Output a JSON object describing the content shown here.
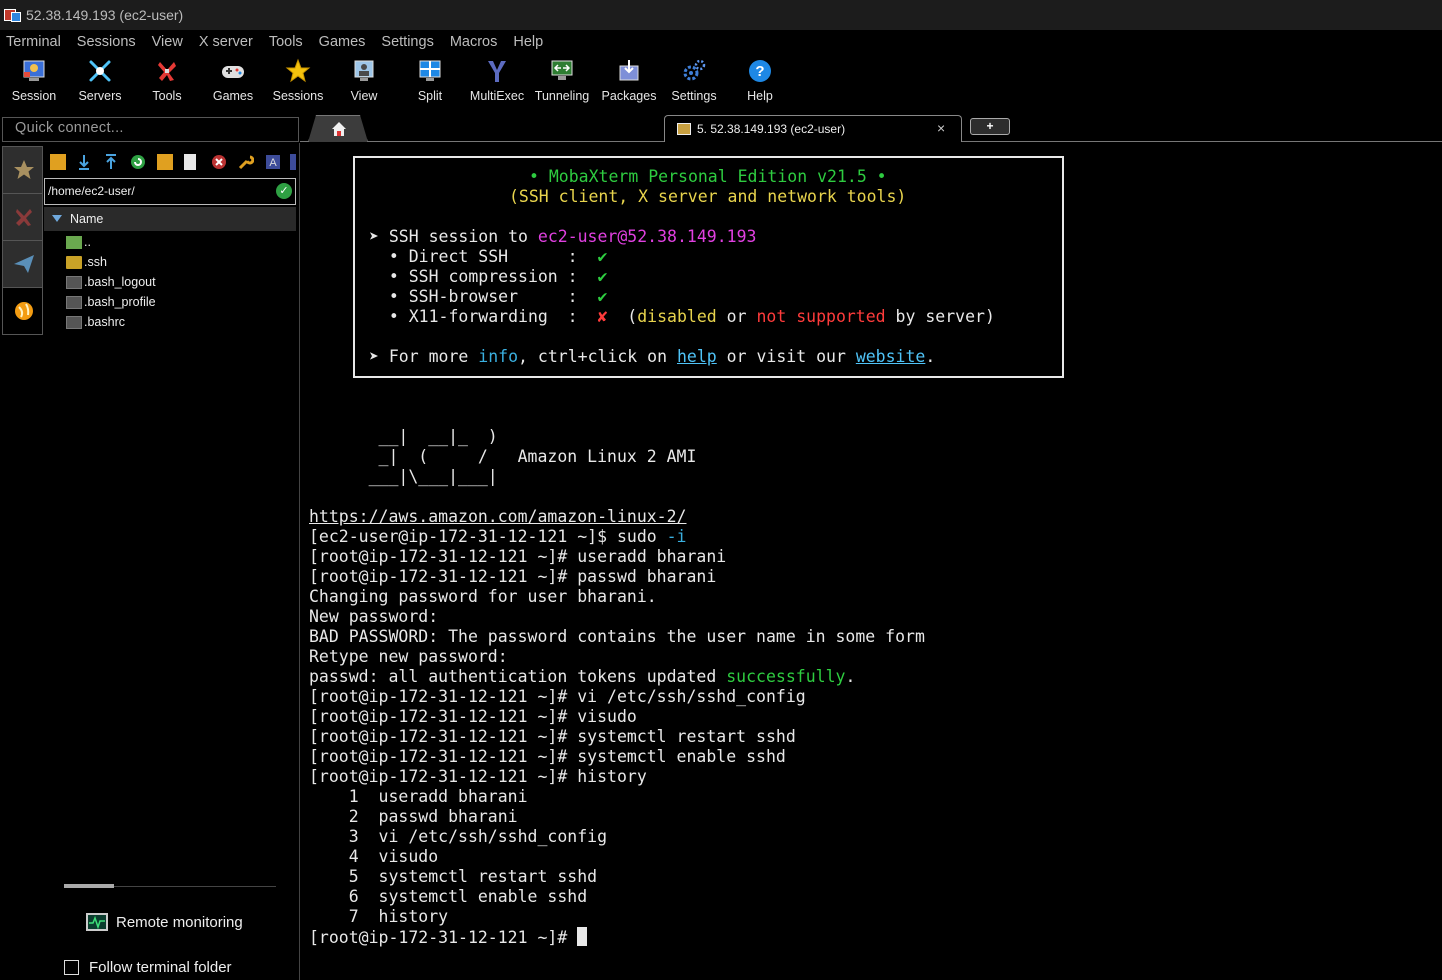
{
  "window": {
    "title": "52.38.149.193 (ec2-user)"
  },
  "menu": [
    "Terminal",
    "Sessions",
    "View",
    "X server",
    "Tools",
    "Games",
    "Settings",
    "Macros",
    "Help"
  ],
  "toolbar": [
    {
      "label": "Session",
      "icon": "session-icon"
    },
    {
      "label": "Servers",
      "icon": "servers-icon"
    },
    {
      "label": "Tools",
      "icon": "tools-icon"
    },
    {
      "label": "Games",
      "icon": "gamepad-icon"
    },
    {
      "label": "Sessions",
      "icon": "star-icon"
    },
    {
      "label": "View",
      "icon": "view-icon"
    },
    {
      "label": "Split",
      "icon": "split-icon"
    },
    {
      "label": "MultiExec",
      "icon": "multiexec-icon"
    },
    {
      "label": "Tunneling",
      "icon": "tunneling-icon"
    },
    {
      "label": "Packages",
      "icon": "packages-icon"
    },
    {
      "label": "Settings",
      "icon": "gears-icon"
    },
    {
      "label": "Help",
      "icon": "help-icon"
    }
  ],
  "quick_connect": {
    "placeholder": "Quick connect..."
  },
  "tabs": {
    "session_label": "5. 52.38.149.193 (ec2-user)",
    "close": "×",
    "new": "+"
  },
  "file_panel": {
    "path": "/home/ec2-user/",
    "column": "Name",
    "files": [
      {
        "name": "..",
        "type": "up"
      },
      {
        "name": ".ssh",
        "type": "folder"
      },
      {
        "name": ".bash_logout",
        "type": "file"
      },
      {
        "name": ".bash_profile",
        "type": "file"
      },
      {
        "name": ".bashrc",
        "type": "file"
      }
    ],
    "remote_monitoring": "Remote monitoring",
    "follow_terminal": "Follow terminal folder"
  },
  "terminal": {
    "banner": {
      "title": "• MobaXterm Personal Edition v21.5 •",
      "subtitle": "(SSH client, X server and network tools)",
      "ssh_prefix": "➤ SSH session to ",
      "ssh_target": "ec2-user@52.38.149.193",
      "items": [
        {
          "label": "  • Direct SSH      :  ",
          "mark": "✔"
        },
        {
          "label": "  • SSH compression :  ",
          "mark": "✔"
        },
        {
          "label": "  • SSH-browser     :  ",
          "mark": "✔"
        },
        {
          "label": "  • X11-forwarding  :  ",
          "mark": "✘"
        }
      ],
      "x11_note_open": "  (",
      "x11_disabled": "disabled",
      "x11_or": " or ",
      "x11_not_supported": "not supported",
      "x11_close": " by server)",
      "more_prefix": "➤ For more ",
      "more_info": "info",
      "more_mid": ", ctrl+click on ",
      "more_help": "help",
      "more_mid2": " or visit our ",
      "more_website": "website",
      "more_end": "."
    },
    "ascii_art": [
      "       __|  __|_  )",
      "       _|  (     /   Amazon Linux 2 AMI",
      "      ___|\\___|___|"
    ],
    "url": "https://aws.amazon.com/amazon-linux-2/",
    "sudo_prompt": "[ec2-user@ip-172-31-12-121 ~]$ sudo ",
    "sudo_flag": "-i",
    "lines_a": [
      "[root@ip-172-31-12-121 ~]# useradd bharani",
      "[root@ip-172-31-12-121 ~]# passwd bharani",
      "Changing password for user bharani.",
      "New password:",
      "BAD PASSWORD: The password contains the user name in some form",
      "Retype new password:"
    ],
    "passwd_prefix": "passwd: all authentication tokens updated ",
    "passwd_success": "successfully",
    "passwd_end": ".",
    "lines_b": [
      "[root@ip-172-31-12-121 ~]# vi /etc/ssh/sshd_config",
      "[root@ip-172-31-12-121 ~]# visudo",
      "[root@ip-172-31-12-121 ~]# systemctl restart sshd",
      "[root@ip-172-31-12-121 ~]# systemctl enable sshd",
      "[root@ip-172-31-12-121 ~]# history",
      "    1  useradd bharani",
      "    2  passwd bharani",
      "    3  vi /etc/ssh/sshd_config",
      "    4  visudo",
      "    5  systemctl restart sshd",
      "    6  systemctl enable sshd",
      "    7  history"
    ],
    "final_prompt": "[root@ip-172-31-12-121 ~]# "
  }
}
